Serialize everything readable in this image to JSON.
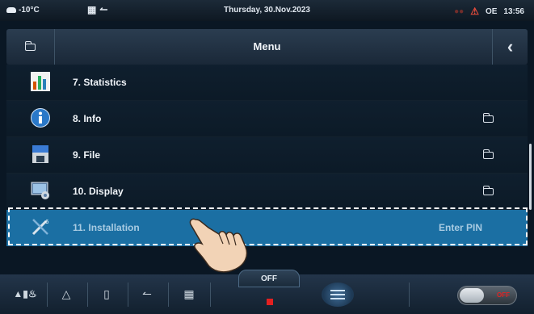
{
  "status_bar": {
    "temperature": "-10°C",
    "date": "Thursday, 30.Nov.2023",
    "mode": "OE",
    "time": "13:56"
  },
  "header": {
    "title": "Menu"
  },
  "menu_items": [
    {
      "label": "7.  Statistics",
      "icon": "statistics-icon",
      "has_folder": false
    },
    {
      "label": "8.  Info",
      "icon": "info-icon",
      "has_folder": true
    },
    {
      "label": "9.  File",
      "icon": "file-icon",
      "has_folder": true
    },
    {
      "label": "10. Display",
      "icon": "display-icon",
      "has_folder": true
    },
    {
      "label": "11. Installation",
      "icon": "installation-icon",
      "right_text": "Enter PIN",
      "selected": true
    }
  ],
  "footer": {
    "off_tab": "OFF",
    "toggle_label": "OFF"
  },
  "colors": {
    "selected_row": "#1b6fa3",
    "background": "#0a1724",
    "off_red": "#e32020"
  }
}
